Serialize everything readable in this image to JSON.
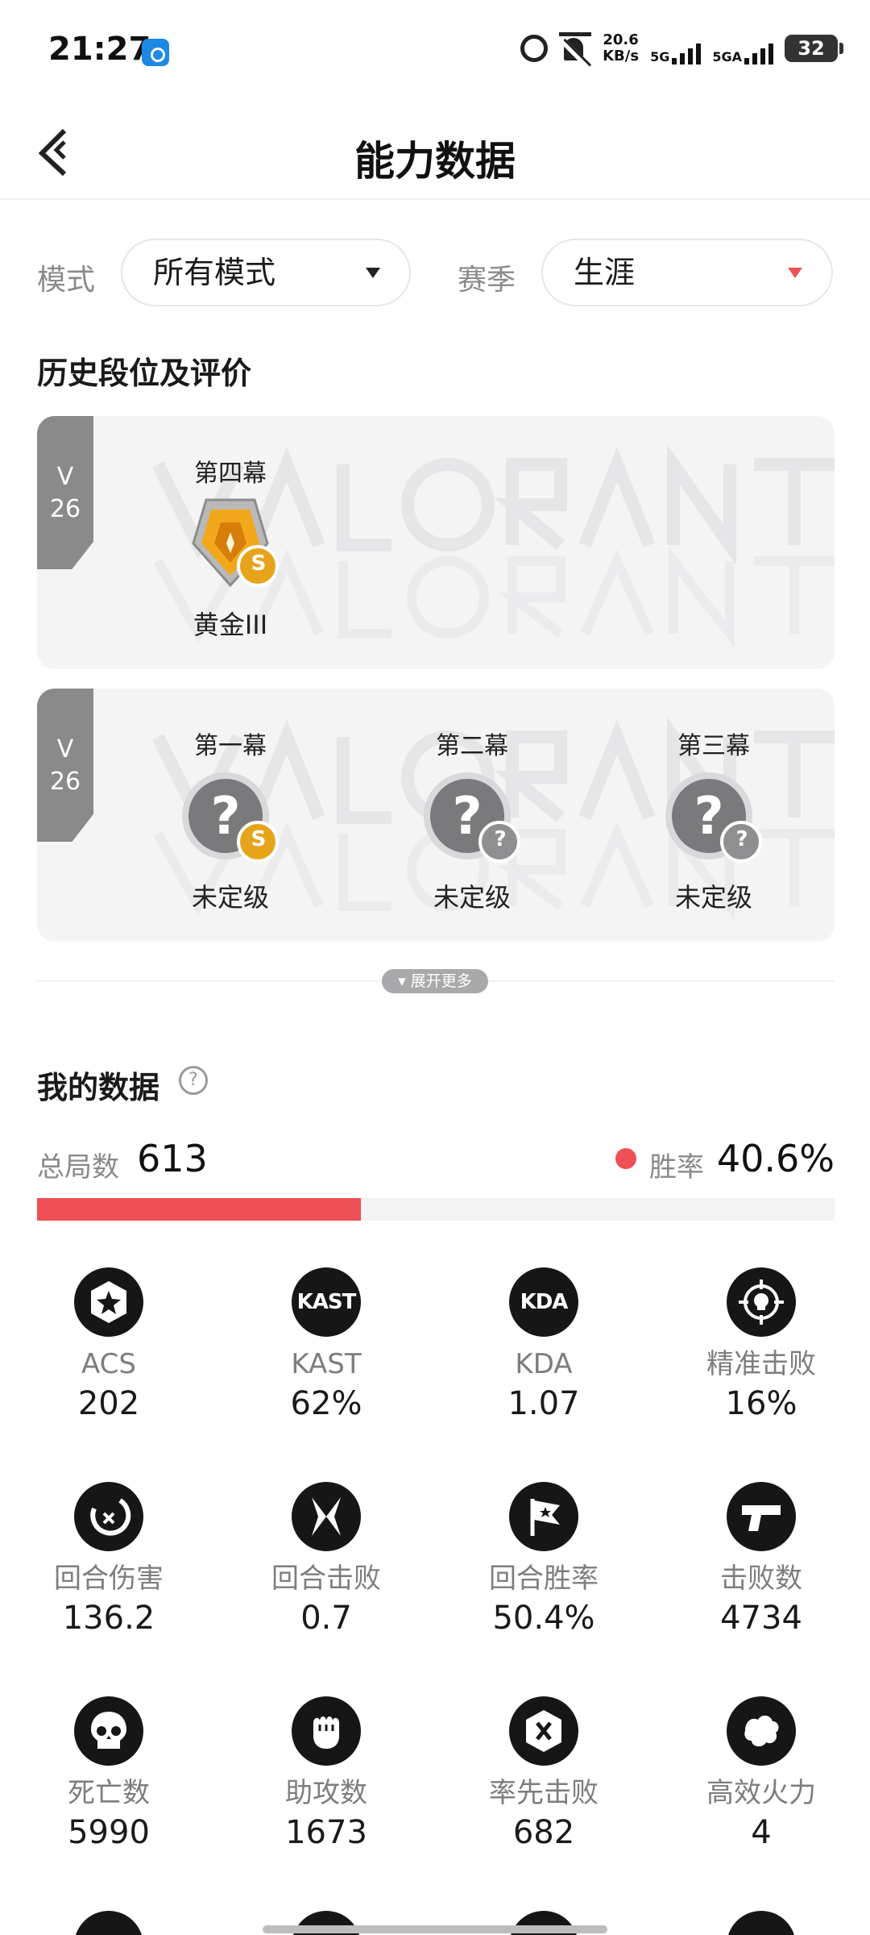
{
  "status_bar": {
    "time": "21:27",
    "speed_value": "20.6",
    "speed_unit": "KB/s",
    "net1": "5G",
    "net2": "5GA",
    "battery": "32"
  },
  "header": {
    "title": "能力数据"
  },
  "filters": {
    "mode_label": "模式",
    "mode_value": "所有模式",
    "season_label": "赛季",
    "season_value": "生涯"
  },
  "history": {
    "title": "历史段位及评价",
    "cards": [
      {
        "version_line1": "V",
        "version_line2": "26",
        "acts": [
          {
            "name": "第四幕",
            "rank": "黄金III",
            "badge": "gold",
            "sub_badge": "S"
          }
        ]
      },
      {
        "version_line1": "V",
        "version_line2": "26",
        "acts": [
          {
            "name": "第一幕",
            "rank": "未定级",
            "badge": "unranked",
            "sub_badge": "S"
          },
          {
            "name": "第二幕",
            "rank": "未定级",
            "badge": "unranked",
            "sub_badge": "?"
          },
          {
            "name": "第三幕",
            "rank": "未定级",
            "badge": "unranked",
            "sub_badge": "?"
          }
        ]
      }
    ],
    "expand_label": "展开更多"
  },
  "my_data": {
    "title": "我的数据",
    "help_glyph": "?",
    "games_label": "总局数",
    "games_value": "613",
    "win_label": "胜率",
    "win_value": "40.6%",
    "win_fraction": 0.406,
    "accent_color": "#ef5056",
    "stats": [
      {
        "label": "ACS",
        "value": "202",
        "icon": "star-badge-icon"
      },
      {
        "label": "KAST",
        "value": "62%",
        "icon": "kast-icon",
        "icon_text": "KAST"
      },
      {
        "label": "KDA",
        "value": "1.07",
        "icon": "kda-icon",
        "icon_text": "KDA"
      },
      {
        "label": "精准击败",
        "value": "16%",
        "icon": "headshot-crosshair-icon"
      },
      {
        "label": "回合伤害",
        "value": "136.2",
        "icon": "damage-icon"
      },
      {
        "label": "回合击败",
        "value": "0.7",
        "icon": "crossed-blades-icon"
      },
      {
        "label": "回合胜率",
        "value": "50.4%",
        "icon": "flag-icon"
      },
      {
        "label": "击败数",
        "value": "4734",
        "icon": "pistol-icon"
      },
      {
        "label": "死亡数",
        "value": "5990",
        "icon": "skull-icon"
      },
      {
        "label": "助攻数",
        "value": "1673",
        "icon": "fist-icon"
      },
      {
        "label": "率先击败",
        "value": "682",
        "icon": "first-blood-icon"
      },
      {
        "label": "高效火力",
        "value": "4",
        "icon": "explosion-icon"
      }
    ]
  }
}
